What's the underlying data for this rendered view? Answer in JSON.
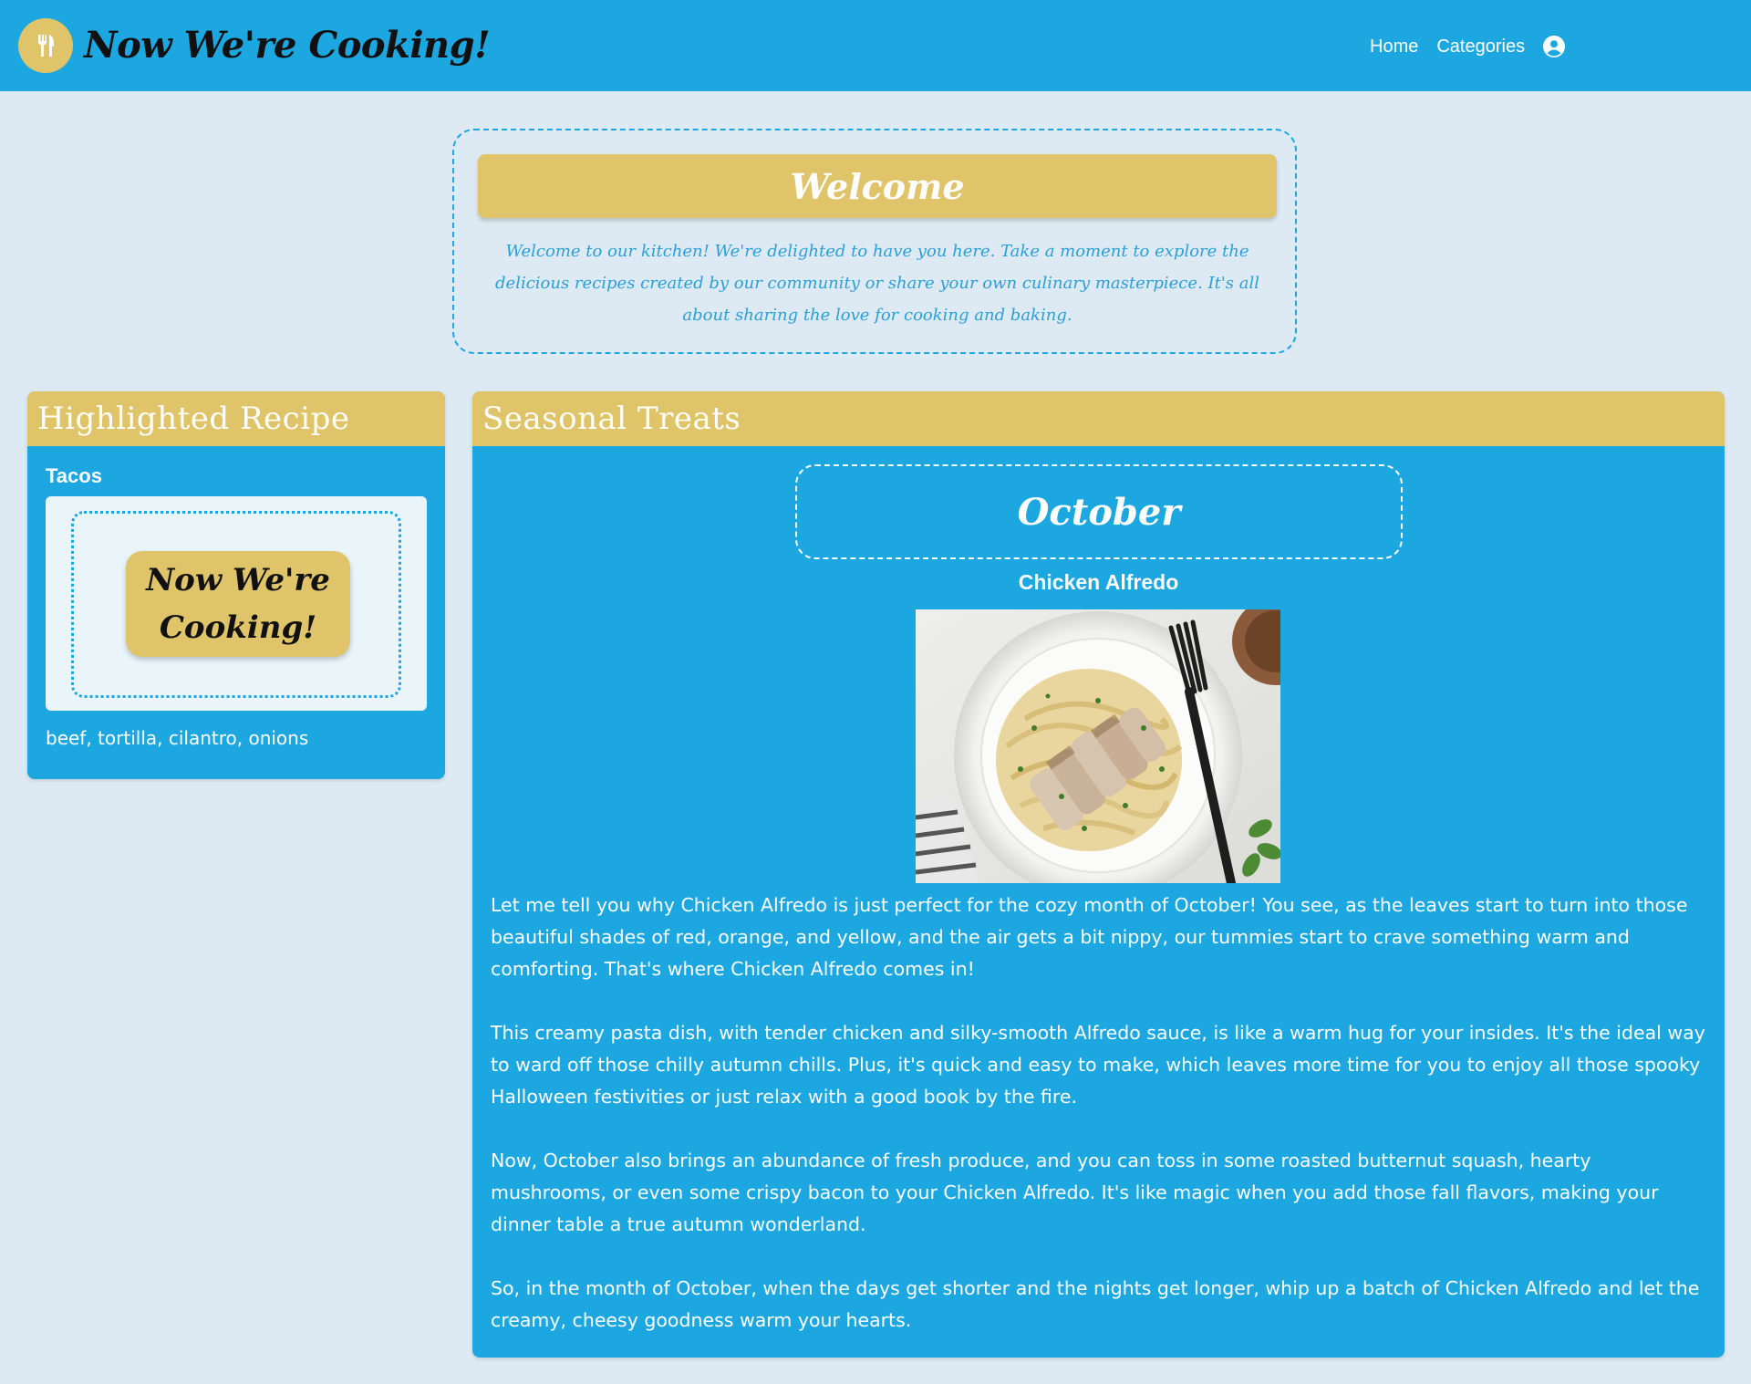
{
  "navbar": {
    "brand": "Now We're Cooking!",
    "logo_icon": "utensils-icon",
    "links": [
      {
        "label": "Home"
      },
      {
        "label": "Categories"
      }
    ],
    "account_icon": "user-circle-icon"
  },
  "welcome": {
    "title": "Welcome",
    "text": "Welcome to our kitchen! We're delighted to have you here. Take a moment to explore the delicious recipes created by our community or share your own culinary masterpiece. It's all about sharing the love for cooking and baking."
  },
  "highlighted": {
    "header": "Highlighted Recipe",
    "title": "Tacos",
    "image_logo_text": "Now We're Cooking!",
    "ingredients": "beef, tortilla, cilantro, onions"
  },
  "seasonal": {
    "header": "Seasonal Treats",
    "month": "October",
    "dish": "Chicken Alfredo",
    "paragraphs": [
      "Let me tell you why Chicken Alfredo is just perfect for the cozy month of October! You see, as the leaves start to turn into those beautiful shades of red, orange, and yellow, and the air gets a bit nippy, our tummies start to crave something warm and comforting. That's where Chicken Alfredo comes in!",
      "This creamy pasta dish, with tender chicken and silky-smooth Alfredo sauce, is like a warm hug for your insides. It's the ideal way to ward off those chilly autumn chills. Plus, it's quick and easy to make, which leaves more time for you to enjoy all those spooky Halloween festivities or just relax with a good book by the fire.",
      "Now, October also brings an abundance of fresh produce, and you can toss in some roasted butternut squash, hearty mushrooms, or even some crispy bacon to your Chicken Alfredo. It's like magic when you add those fall flavors, making your dinner table a true autumn wonderland.",
      "So, in the month of October, when the days get shorter and the nights get longer, whip up a batch of Chicken Alfredo and let the creamy, cheesy goodness warm your hearts."
    ]
  },
  "colors": {
    "primary_blue": "#1ca7e0",
    "accent_gold": "#dfc469",
    "page_background": "#deeaf3"
  }
}
